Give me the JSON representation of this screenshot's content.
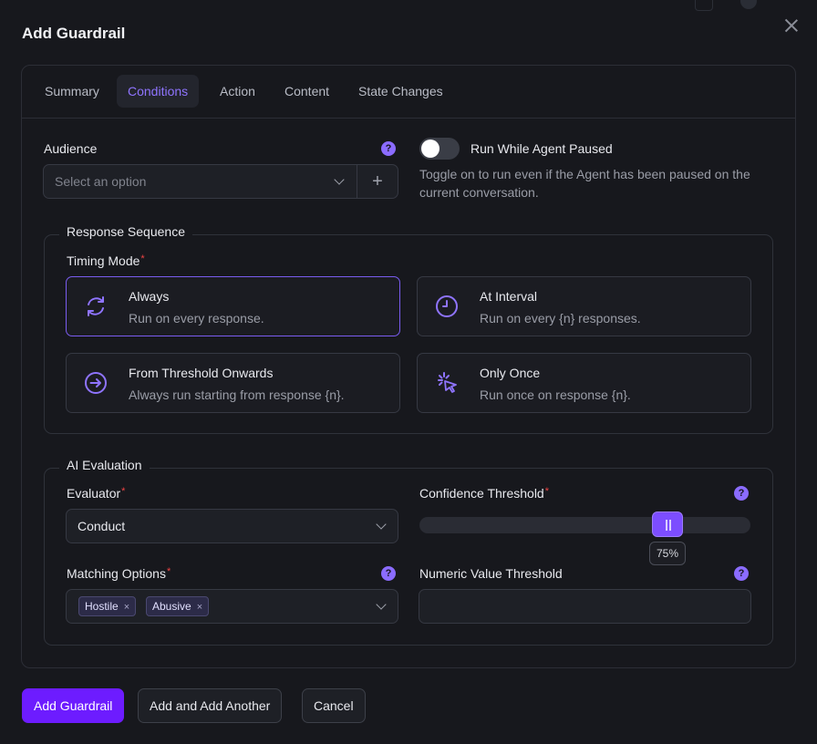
{
  "dialog": {
    "title": "Add Guardrail"
  },
  "tabs": [
    {
      "label": "Summary"
    },
    {
      "label": "Conditions"
    },
    {
      "label": "Action"
    },
    {
      "label": "Content"
    },
    {
      "label": "State Changes"
    }
  ],
  "active_tab": "Conditions",
  "audience": {
    "label": "Audience",
    "placeholder": "Select an option"
  },
  "run_while_paused": {
    "label": "Run While Agent Paused",
    "description_line1": "Toggle on to run even if the Agent has been paused on the",
    "description_line2": "current conversation.",
    "enabled": false
  },
  "response_sequence": {
    "legend": "Response Sequence",
    "timing_mode_label": "Timing Mode",
    "required_mark": "*",
    "options": [
      {
        "title": "Always",
        "description": "Run on every response.",
        "icon": "refresh-icon",
        "selected": true
      },
      {
        "title": "At Interval",
        "description": "Run on every {n} responses.",
        "icon": "clock-icon",
        "selected": false
      },
      {
        "title": "From Threshold Onwards",
        "description": "Always run starting from response {n}.",
        "icon": "arrow-circle-right-icon",
        "selected": false
      },
      {
        "title": "Only Once",
        "description": "Run once on response {n}.",
        "icon": "click-pointer-icon",
        "selected": false
      }
    ]
  },
  "ai_evaluation": {
    "legend": "AI Evaluation",
    "evaluator": {
      "label": "Evaluator",
      "required_mark": "*",
      "value": "Conduct"
    },
    "confidence_threshold": {
      "label": "Confidence Threshold",
      "required_mark": "*",
      "value_percent": 75,
      "display": "75%"
    },
    "matching_options": {
      "label": "Matching Options",
      "required_mark": "*",
      "tags": [
        {
          "label": "Hostile",
          "remove": "×"
        },
        {
          "label": "Abusive",
          "remove": "×"
        }
      ]
    },
    "numeric_value_threshold": {
      "label": "Numeric Value Threshold",
      "value": ""
    }
  },
  "help_icon": "?",
  "add_icon": "+",
  "footer": {
    "primary": "Add Guardrail",
    "add_another": "Add and Add Another",
    "cancel": "Cancel"
  },
  "colors": {
    "accent": "#6d1cff",
    "accent_text": "#8f74ff",
    "background": "#17181d",
    "border": "#363943"
  }
}
